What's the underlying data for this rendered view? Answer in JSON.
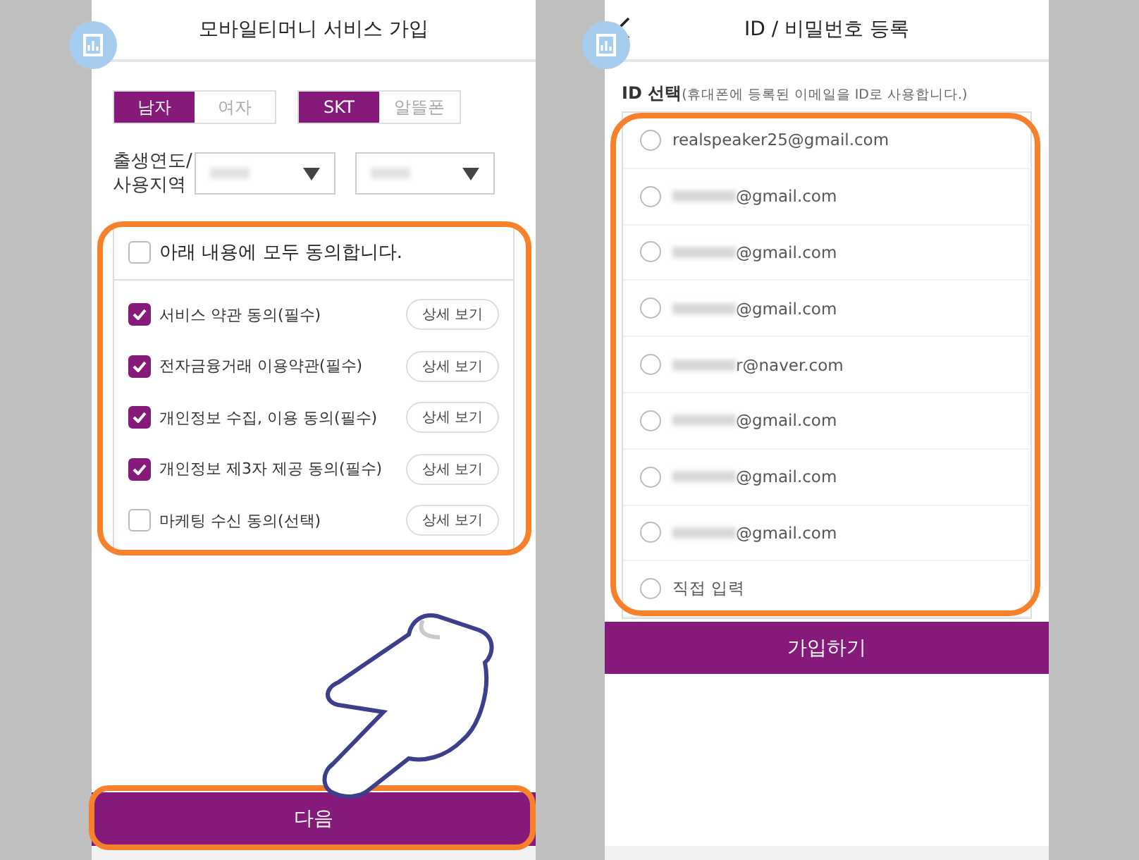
{
  "left_screen": {
    "title": "모바일티머니 서비스 가입",
    "gender_options": [
      {
        "label": "남자",
        "selected": true
      },
      {
        "label": "여자",
        "selected": false
      }
    ],
    "carrier_options": [
      {
        "label": "SKT",
        "selected": true
      },
      {
        "label": "알뜰폰",
        "selected": false
      }
    ],
    "birth_region": {
      "label_lines": [
        "출생연도/",
        "사용지역"
      ],
      "selects": [
        {
          "redacted": true
        },
        {
          "redacted": true
        }
      ]
    },
    "agree_all": {
      "label": "아래 내용에 모두 동의합니다.",
      "checked": false
    },
    "agreements": [
      {
        "label": "서비스 약관 동의(필수)",
        "checked": true,
        "button": "상세 보기"
      },
      {
        "label": "전자금융거래 이용약관(필수)",
        "checked": true,
        "button": "상세 보기"
      },
      {
        "label": "개인정보 수집, 이용 동의(필수)",
        "checked": true,
        "button": "상세 보기"
      },
      {
        "label": "개인정보 제3자 제공 동의(필수)",
        "checked": true,
        "button": "상세 보기"
      },
      {
        "label": "마케팅 수신 동의(선택)",
        "checked": false,
        "button": "상세 보기"
      }
    ],
    "next_button": "다음"
  },
  "right_screen": {
    "title": "ID / 비밀번호 등록",
    "id_label": "ID 선택",
    "id_hint": "(휴대폰에 등록된 이메일을 ID로 사용합니다.)",
    "id_options": [
      {
        "text": "realspeaker25@gmail.com",
        "redacted_prefix": false,
        "selected": false
      },
      {
        "text": "@gmail.com",
        "redacted_prefix": true,
        "selected": false
      },
      {
        "text": "@gmail.com",
        "redacted_prefix": true,
        "selected": false
      },
      {
        "text": "@gmail.com",
        "redacted_prefix": true,
        "selected": false
      },
      {
        "text": "r@naver.com",
        "redacted_prefix": true,
        "selected": false
      },
      {
        "text": "@gmail.com",
        "redacted_prefix": true,
        "selected": false
      },
      {
        "text": "@gmail.com",
        "redacted_prefix": true,
        "selected": false
      },
      {
        "text": "@gmail.com",
        "redacted_prefix": true,
        "selected": false
      },
      {
        "text": "직접 입력",
        "redacted_prefix": false,
        "selected": false
      }
    ],
    "submit_button": "가입하기"
  }
}
